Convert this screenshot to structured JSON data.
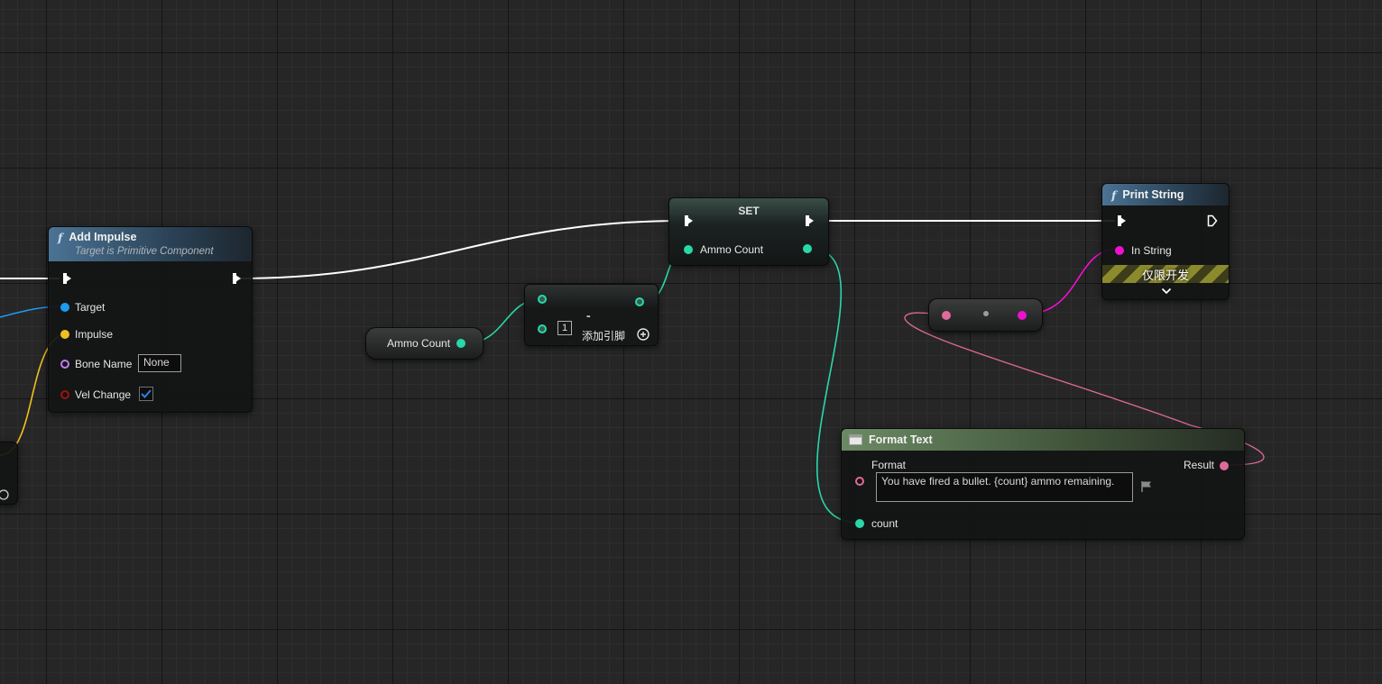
{
  "colors": {
    "exec": "#ffffff",
    "object_pin": "#1a9cf0",
    "vector_pin": "#f0c020",
    "name_pin": "#c07cf0",
    "bool_pin": "#a01010",
    "int_pin": "#28d8a8",
    "string_pin": "#f010d0",
    "text_pin": "#e06a9a",
    "checkbox_tick": "#2f7fe0"
  },
  "add_impulse": {
    "title": "Add Impulse",
    "subtitle": "Target is Primitive Component",
    "func_icon": "function-icon",
    "pins": {
      "target": "Target",
      "impulse": "Impulse",
      "bone_name": "Bone Name",
      "vel_change": "Vel Change"
    },
    "bone_name_value": "None",
    "vel_change_checked": true
  },
  "ammo_getter": {
    "label": "Ammo Count"
  },
  "subtract_node": {
    "operator": "-",
    "second_input_value": "1",
    "add_pin_label": "添加引脚",
    "add_pin_icon": "plus-circle-icon"
  },
  "set_node": {
    "title": "SET",
    "variable_label": "Ammo Count"
  },
  "print_string": {
    "title": "Print String",
    "func_icon": "function-icon",
    "in_string_label": "In String",
    "dev_only_label": "仅限开发",
    "expand_icon": "chevron-down-icon"
  },
  "format_text": {
    "title": "Format Text",
    "format_label": "Format",
    "format_value": "You have fired a bullet. {count} ammo remaining.",
    "result_label": "Result",
    "count_label": "count",
    "localize_icon": "flag-icon"
  }
}
